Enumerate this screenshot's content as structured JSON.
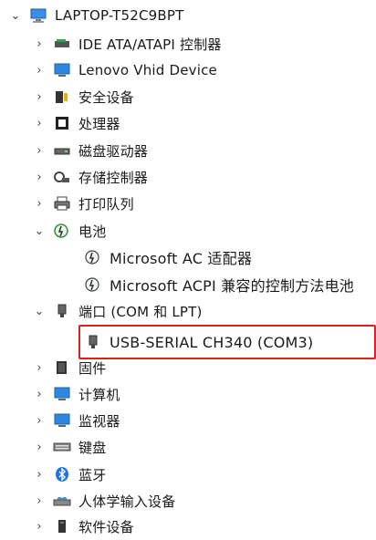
{
  "root": {
    "label": "LAPTOP-T52C9BPT"
  },
  "categories": [
    {
      "label": "IDE ATA/ATAPI 控制器",
      "icon": "ide-controller-icon"
    },
    {
      "label": "Lenovo Vhid Device",
      "icon": "monitor-icon"
    },
    {
      "label": "安全设备",
      "icon": "security-device-icon"
    },
    {
      "label": "处理器",
      "icon": "processor-icon"
    },
    {
      "label": "磁盘驱动器",
      "icon": "disk-drive-icon"
    },
    {
      "label": "存储控制器",
      "icon": "storage-controller-icon"
    },
    {
      "label": "打印队列",
      "icon": "printer-icon"
    },
    {
      "label": "电池",
      "icon": "battery-icon",
      "children": [
        {
          "label": "Microsoft AC 适配器",
          "icon": "battery-device-icon"
        },
        {
          "label": "Microsoft ACPI 兼容的控制方法电池",
          "icon": "battery-device-icon"
        }
      ]
    },
    {
      "label": "端口 (COM 和 LPT)",
      "icon": "port-icon",
      "children": [
        {
          "label": "USB-SERIAL CH340 (COM3)",
          "icon": "port-icon"
        }
      ]
    },
    {
      "label": "固件",
      "icon": "firmware-icon"
    },
    {
      "label": "计算机",
      "icon": "computer-icon"
    },
    {
      "label": "监视器",
      "icon": "monitor-icon"
    },
    {
      "label": "键盘",
      "icon": "keyboard-icon"
    },
    {
      "label": "蓝牙",
      "icon": "bluetooth-icon"
    },
    {
      "label": "人体学输入设备",
      "icon": "hid-icon"
    },
    {
      "label": "软件设备",
      "icon": "software-device-icon"
    }
  ],
  "highlight_color": "#e02020"
}
